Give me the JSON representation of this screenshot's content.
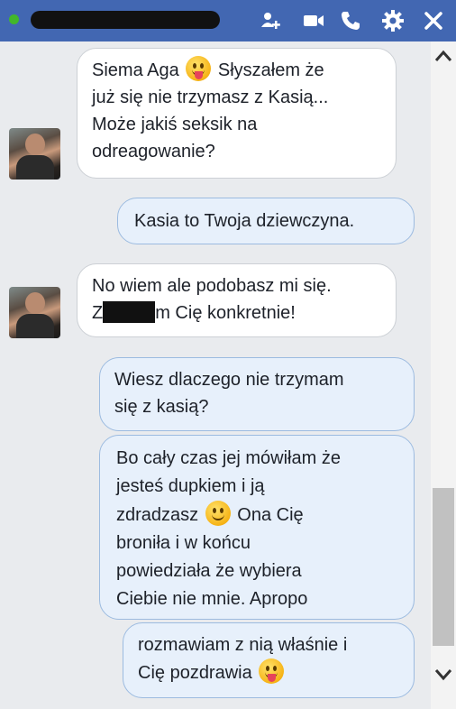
{
  "header": {
    "contact_name": "",
    "icons": [
      "add-friend-icon",
      "video-call-icon",
      "phone-icon",
      "settings-gear-icon",
      "close-icon"
    ]
  },
  "messages": [
    {
      "side": "incoming",
      "parts": [
        "Siema Aga",
        "[tongue-emoji]",
        "Słyszałem że już się nie trzymasz z Kasią... Może jakiś seksik na odreagowanie?"
      ]
    },
    {
      "side": "outgoing",
      "text": "Kasia to Twoja dziewczyna."
    },
    {
      "side": "incoming",
      "parts": [
        "No wiem ale podobasz mi się. Z",
        "[redacted]",
        "m Cię konkretnie!"
      ]
    },
    {
      "side": "outgoing",
      "text": "Wiesz dlaczego nie trzymam się z kasią?"
    },
    {
      "side": "outgoing",
      "parts": [
        "Bo cały czas jej mówiłam że jesteś dupkiem i ją zdradzasz",
        "[smile-emoji]",
        "Ona Cię broniła i w końcu powiedziała że wybiera Ciebie nie mnie. Apropo"
      ]
    },
    {
      "side": "outgoing",
      "parts": [
        "rozmawiam z nią właśnie i Cię pozdrawia",
        "[tongue-emoji]"
      ]
    }
  ],
  "m1": {
    "line1a": "Siema Aga",
    "line1b": "Słyszałem że",
    "line2": "już się nie trzymasz z Kasią...",
    "line3": "Może jakiś seksik na",
    "line4": "odreagowanie?"
  },
  "m2": {
    "text": "Kasia to Twoja dziewczyna."
  },
  "m3": {
    "line1": "No wiem ale podobasz mi się.",
    "line2a": "Z",
    "line2b": "m Cię konkretnie!"
  },
  "m4": {
    "line1": "Wiesz dlaczego nie trzymam",
    "line2": "się z kasią?"
  },
  "m5": {
    "line1": "Bo cały czas jej mówiłam że",
    "line2": "jesteś dupkiem i ją",
    "line3a": "zdradzasz",
    "line3b": "Ona Cię",
    "line4": "broniła i w końcu",
    "line5": "powiedziała że wybiera",
    "line6": "Ciebie nie mnie. Apropo"
  },
  "m6": {
    "line1": "rozmawiam z nią właśnie i",
    "line2": "Cię pozdrawia"
  },
  "colors": {
    "header": "#4267b2",
    "online": "#42b72a",
    "outgoing_bubble": "#e7f0fb",
    "incoming_bubble": "#ffffff"
  }
}
